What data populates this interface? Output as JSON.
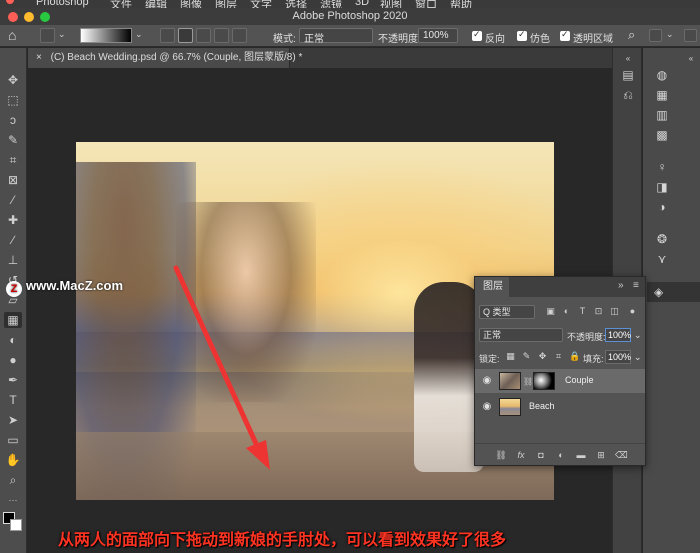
{
  "menubar": {
    "app_name": "Photoshop",
    "items": [
      "文件",
      "编辑",
      "图像",
      "图层",
      "文字",
      "选择",
      "滤镜",
      "3D",
      "视图",
      "窗口",
      "帮助"
    ],
    "traffic_colors": [
      "#ff5f57",
      "#febc2e",
      "#28c840"
    ]
  },
  "window": {
    "title": "Adobe Photoshop 2020"
  },
  "options_bar": {
    "home_icon": "home-icon",
    "mode_label": "模式:",
    "mode_value": "正常",
    "opacity_label": "不透明度:",
    "opacity_value": "100%",
    "reverse_label": "反向",
    "dither_label": "仿色",
    "transparency_label": "透明区域"
  },
  "document": {
    "tab_title": "(C) Beach Wedding.psd @ 66.7% (Couple, 图层蒙版/8) *",
    "close_glyph": "×"
  },
  "layers_panel": {
    "tab_label": "图层",
    "collapse_glyph": "»",
    "menu_glyph": "≡",
    "filter_label": "Q 类型",
    "blend_mode": "正常",
    "opacity_label": "不透明度:",
    "opacity_value": "100%",
    "lock_label": "锁定:",
    "fill_label": "填充:",
    "fill_value": "100%",
    "layers": [
      {
        "name": "Couple",
        "selected": true,
        "has_mask": true
      },
      {
        "name": "Beach",
        "selected": false,
        "has_mask": false
      }
    ],
    "footer_icons": [
      "link-icon",
      "fx-icon",
      "mask-icon",
      "adjustment-icon",
      "folder-icon",
      "new-layer-icon",
      "trash-icon"
    ]
  },
  "overlay": {
    "watermark": "www.MacZ.com",
    "watermark_logo_letter": "Z",
    "caption": "从两人的面部向下拖动到新娘的手肘处，可以看到效果好了很多",
    "arrow_color": "#ee3333",
    "caption_color": "#ff3322"
  }
}
